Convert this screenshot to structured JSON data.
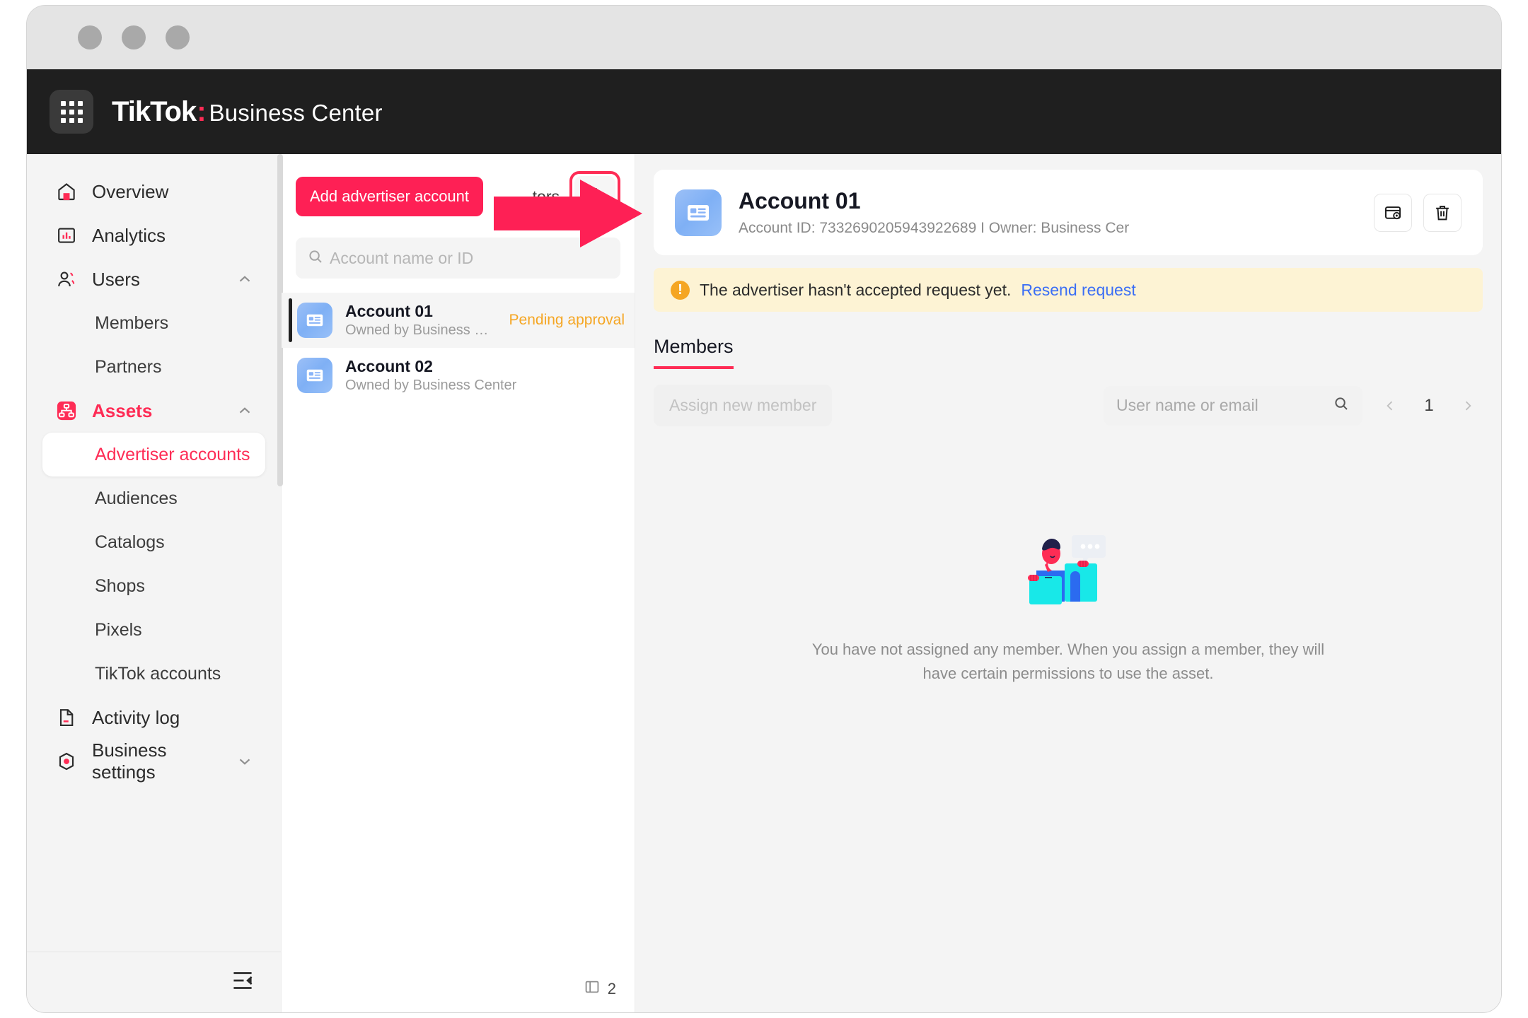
{
  "window": {
    "dots": [
      "minimize",
      "maximize",
      "close"
    ]
  },
  "header": {
    "apps_icon": "grid-apps-icon",
    "brand_tiktok": "TikTok",
    "brand_colon": ":",
    "brand_product": "Business Center"
  },
  "sidebar": {
    "items": [
      {
        "label": "Overview",
        "icon": "home-icon",
        "level": "top",
        "state": "default",
        "chevron": ""
      },
      {
        "label": "Analytics",
        "icon": "analytics-icon",
        "level": "top",
        "state": "default",
        "chevron": ""
      },
      {
        "label": "Users",
        "icon": "users-icon",
        "level": "top",
        "state": "default",
        "chevron": "chevron-up-icon"
      },
      {
        "label": "Members",
        "icon": "",
        "level": "sub",
        "state": "default",
        "chevron": ""
      },
      {
        "label": "Partners",
        "icon": "",
        "level": "sub",
        "state": "default",
        "chevron": ""
      },
      {
        "label": "Assets",
        "icon": "assets-icon",
        "level": "top",
        "state": "parent-active",
        "chevron": "chevron-up-icon"
      },
      {
        "label": "Advertiser accounts",
        "icon": "",
        "level": "sub",
        "state": "active",
        "chevron": ""
      },
      {
        "label": "Audiences",
        "icon": "",
        "level": "sub",
        "state": "default",
        "chevron": ""
      },
      {
        "label": "Catalogs",
        "icon": "",
        "level": "sub",
        "state": "default",
        "chevron": ""
      },
      {
        "label": "Shops",
        "icon": "",
        "level": "sub",
        "state": "default",
        "chevron": ""
      },
      {
        "label": "Pixels",
        "icon": "",
        "level": "sub",
        "state": "default",
        "chevron": ""
      },
      {
        "label": "TikTok accounts",
        "icon": "",
        "level": "sub",
        "state": "default",
        "chevron": ""
      },
      {
        "label": "Activity log",
        "icon": "document-icon",
        "level": "top",
        "state": "default",
        "chevron": ""
      },
      {
        "label": "Business settings",
        "icon": "settings-gear-icon",
        "level": "top",
        "state": "default",
        "chevron": "chevron-down-icon"
      }
    ],
    "collapse_icon": "collapse-sidebar-icon"
  },
  "list_panel": {
    "add_button": "Add advertiser account",
    "filters_label": "ters",
    "export_icon": "export-file-icon",
    "search_placeholder": "Account name or ID",
    "search_icon": "search-icon",
    "accounts": [
      {
        "name": "Account 01",
        "owner": "Owned by Business Cen...",
        "status": "Pending approval",
        "icon": "ad-account-card-icon",
        "selected": true
      },
      {
        "name": "Account 02",
        "owner": "Owned by Business Center",
        "status": "",
        "icon": "ad-account-card-icon",
        "selected": false
      }
    ],
    "footer_count": "2",
    "footer_icon": "account-count-icon"
  },
  "detail": {
    "icon": "ad-account-card-icon",
    "title": "Account 01",
    "meta": "Account ID: 7332690205943922689 I Owner: Business Cer",
    "actions": [
      {
        "icon": "payment-settings-icon",
        "name": "payment-settings-button"
      },
      {
        "icon": "trash-icon",
        "name": "delete-account-button"
      }
    ],
    "banner": {
      "icon": "warning-icon",
      "text": "The advertiser hasn't accepted request yet.",
      "link": "Resend request"
    },
    "tab": "Members",
    "assign_button": "Assign new member",
    "member_search_placeholder": "User name or email",
    "member_search_icon": "search-icon",
    "pager": {
      "prev_icon": "chevron-left-icon",
      "page": "1",
      "next_icon": "chevron-right-icon"
    },
    "empty_state": {
      "illustration": "no-members-illustration",
      "text": "You have not assigned any member. When you assign a member, they will have certain permissions to use the asset."
    }
  },
  "annotation": {
    "arrow": "red-pointer-arrow",
    "highlight": "pink-highlight-box"
  },
  "colors": {
    "brand_pink": "#fe2c55",
    "accent_pink": "#fe2055",
    "warning_yellow": "#fdf3d4",
    "warning_icon": "#f5a623",
    "link_blue": "#3b6ef5",
    "header_dark": "#1f1f1f"
  }
}
